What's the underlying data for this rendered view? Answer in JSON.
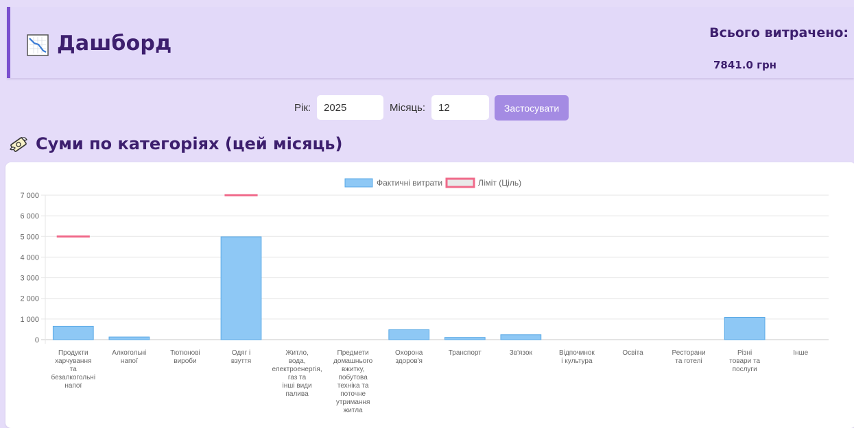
{
  "header": {
    "title": "Дашборд",
    "icon": "chart-decreasing-icon",
    "total_label": "Всього витрачено:",
    "total_value": "7841.0 грн"
  },
  "filters": {
    "year_label": "Рік:",
    "year_value": "2025",
    "month_label": "Місяць:",
    "month_value": "12",
    "apply_label": "Застосувати"
  },
  "section": {
    "icon": "money-with-wings-icon",
    "title": "Суми по категоріях (цей місяць)"
  },
  "colors": {
    "bar_fill": "#8ec8f5",
    "bar_stroke": "#5aa9e6",
    "limit_line": "#f06a8a",
    "header_accent": "#7b4fcf",
    "button": "#a48be3",
    "title_text": "#3d1f6e"
  },
  "chart_data": {
    "type": "bar",
    "categories": [
      [
        "Продукти",
        "харчування",
        "та",
        "безалкогольні",
        "напої"
      ],
      [
        "Алкогольні",
        "напої"
      ],
      [
        "Тютюнові",
        "вироби"
      ],
      [
        "Одяг і",
        "взуття"
      ],
      [
        "Житло,",
        "вода,",
        "електроенергія,",
        "газ та",
        "інші види",
        "палива"
      ],
      [
        "Предмети",
        "домашнього",
        "вжитку,",
        "побутова",
        "техніка та",
        "поточне",
        "утримання",
        "житла"
      ],
      [
        "Охорона",
        "здоров'я"
      ],
      [
        "Транспорт"
      ],
      [
        "Зв'язок"
      ],
      [
        "Відпочинок",
        "і культура"
      ],
      [
        "Освіта"
      ],
      [
        "Ресторани",
        "та готелі"
      ],
      [
        "Різні",
        "товари та",
        "послуги"
      ],
      [
        "Інше"
      ]
    ],
    "series": [
      {
        "name": "Фактичні витрати",
        "type": "bar",
        "values": [
          650,
          130,
          0,
          4980,
          0,
          0,
          480,
          110,
          240,
          0,
          0,
          0,
          1080,
          0
        ]
      },
      {
        "name": "Ліміт (Ціль)",
        "type": "line-marker",
        "values": [
          5000,
          null,
          null,
          7000,
          null,
          null,
          null,
          null,
          null,
          null,
          null,
          null,
          null,
          null
        ]
      }
    ],
    "yticks": [
      "0",
      "1 000",
      "2 000",
      "3 000",
      "4 000",
      "5 000",
      "6 000",
      "7 000"
    ],
    "ylim": [
      0,
      7000
    ],
    "legend_position": "top-center",
    "grid": true
  }
}
